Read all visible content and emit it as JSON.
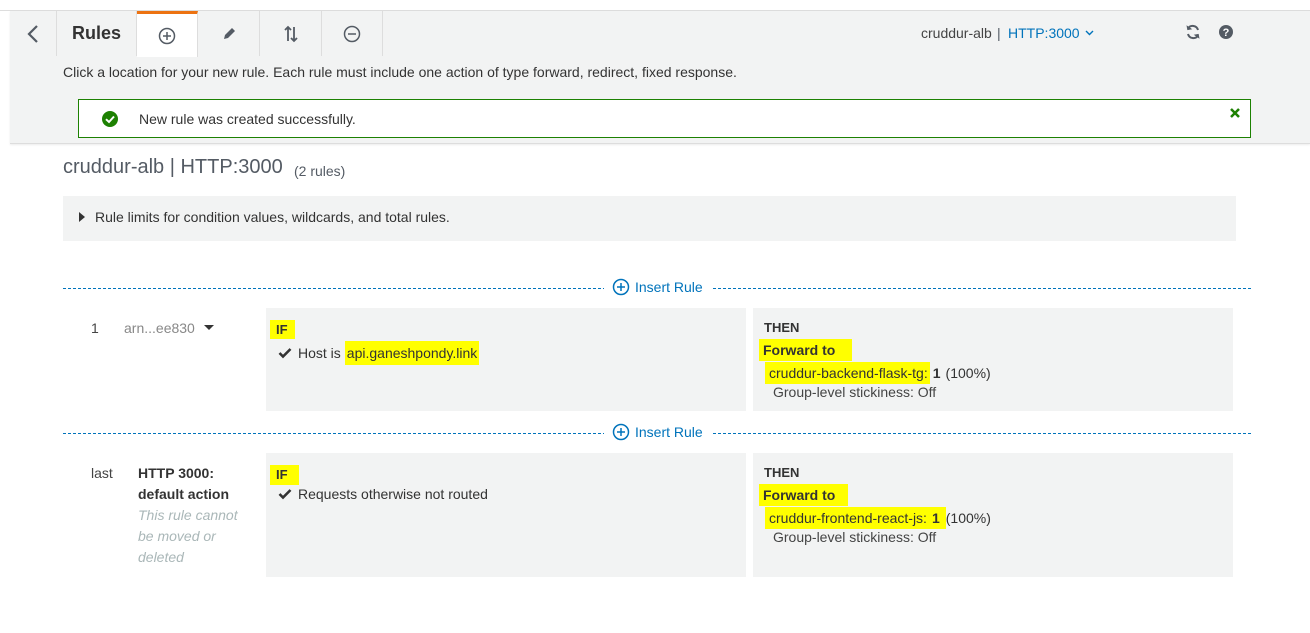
{
  "toolbar": {
    "title": "Rules",
    "load_balancer": "cruddur-alb",
    "separator": "|",
    "listener": "HTTP:3000"
  },
  "instruction": "Click a location for your new rule. Each rule must include one action of type forward, redirect, fixed response.",
  "alert": {
    "message": "New rule was created successfully."
  },
  "page": {
    "title": "cruddur-alb | HTTP:3000",
    "rules_count": "(2 rules)",
    "limits_text": "Rule limits for condition values, wildcards, and total rules."
  },
  "insert_rule_label": "Insert Rule",
  "rules": [
    {
      "number": "1",
      "arn": "arn...ee830",
      "if_label": "IF",
      "condition_prefix": "Host is",
      "condition_value": "api.ganeshpondy.link",
      "then_label": "THEN",
      "action": "Forward to",
      "target_group": "cruddur-backend-flask-tg:",
      "weight": "1",
      "percent": "(100%)",
      "stickiness": "Group-level stickiness: Off"
    },
    {
      "number": "last",
      "default_title_line1": "HTTP 3000:",
      "default_title_line2": "default action",
      "note_line1": "This rule cannot",
      "note_line2": "be moved or",
      "note_line3": "deleted",
      "if_label": "IF",
      "condition": "Requests otherwise not routed",
      "then_label": "THEN",
      "action": "Forward to",
      "target_group": "cruddur-frontend-react-js:",
      "weight": "1",
      "percent": "(100%)",
      "stickiness": "Group-level stickiness: Off"
    }
  ],
  "colors": {
    "accent_tab": "#ec7211",
    "link": "#0073bb",
    "success": "#1d8102",
    "highlight": "#ffff00"
  },
  "icons": [
    "back-chevron-icon",
    "add-circle-icon",
    "pencil-icon",
    "reorder-arrows-icon",
    "remove-circle-icon",
    "chevron-down-icon",
    "refresh-icon",
    "help-icon",
    "success-check-icon",
    "close-x-icon",
    "caret-right-icon",
    "plus-circle-icon",
    "checkmark-icon",
    "caret-down-icon"
  ]
}
